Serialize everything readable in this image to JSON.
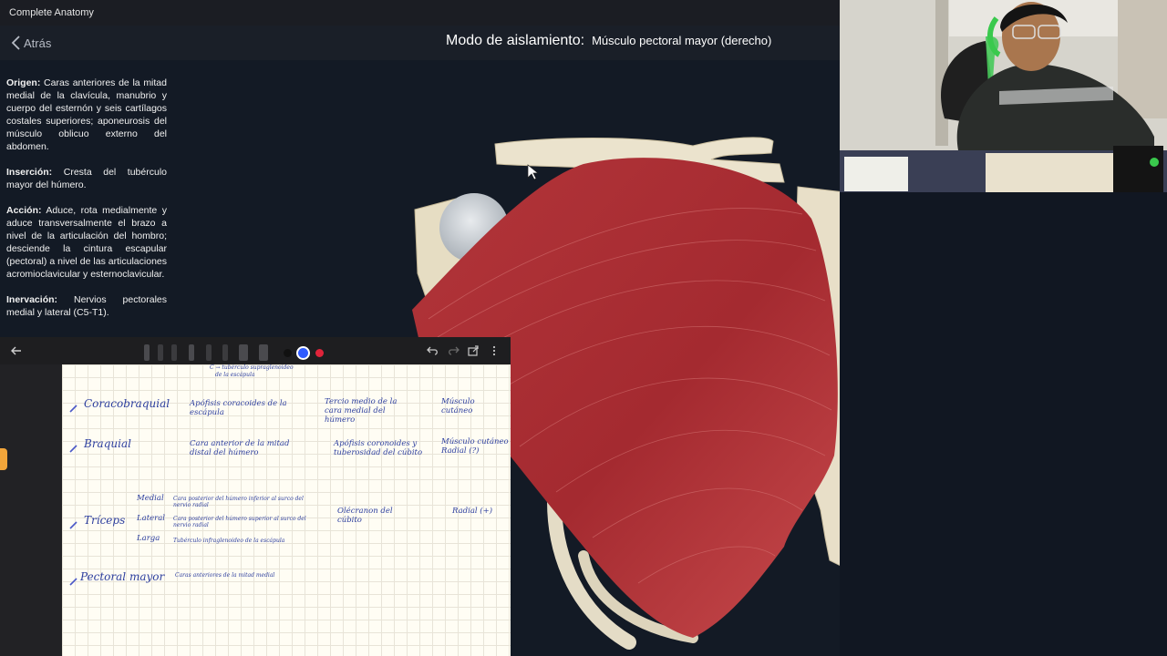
{
  "app": {
    "window_title": "Complete Anatomy",
    "back_label": "Atrás",
    "mode_label": "Modo de aislamiento:",
    "muscle_name": "Músculo pectoral mayor (derecho)"
  },
  "info": {
    "origen_label": "Origen:",
    "origen_text": "Caras anteriores de la mitad medial de la clavícula, manubrio y cuerpo del esternón y seis cartílagos costales superiores; aponeurosis del músculo oblicuo externo del abdomen.",
    "insercion_label": "Inserción:",
    "insercion_text": "Cresta del tubérculo mayor del húmero.",
    "accion_label": "Acción:",
    "accion_text": "Aduce, rota medialmente y aduce transversalmente el brazo a nivel de la articulación del hombro; desciende la cintura escapular (pectoral) a nivel de las articulaciones acromioclavicular y esternoclavicular.",
    "inervacion_label": "Inervación:",
    "inervacion_text": "Nervios pectorales medial y lateral (C5-T1)."
  },
  "notes": {
    "colors": {
      "ink": "#2c3e9e",
      "swatch_black": "#111111",
      "swatch_blue": "#2f5bff",
      "swatch_red": "#e0243a"
    },
    "top_fragment_1": "C  → tubérculo supraglenoideo",
    "top_fragment_2": "de la escápula",
    "rows": [
      {
        "muscle": "Coracobraquial",
        "origin": "Apófisis coracoides de la escápula",
        "insertion": "Tercio medio de la cara medial del húmero",
        "nerve": "Músculo cutáneo"
      },
      {
        "muscle": "Braquial",
        "origin": "Cara anterior de la mitad distal del húmero",
        "insertion": "Apófisis coronoides y tuberosidad del cúbito",
        "nerve": "Músculo cutáneo Radial (?)"
      },
      {
        "muscle": "Tríceps",
        "heads": [
          {
            "name": "Medial",
            "origin": "Cara posterior del húmero inferior al surco del nervio radial"
          },
          {
            "name": "Lateral",
            "origin": "Cara posterior del húmero superior al surco del nervio radial"
          },
          {
            "name": "Larga",
            "origin": "Tubérculo infraglenoideo de la escápula"
          }
        ],
        "insertion": "Olécranon del cúbito",
        "nerve": "Radial (+)"
      },
      {
        "muscle": "Pectoral mayor",
        "origin": "Caras anteriores de la mitad medial"
      }
    ]
  }
}
